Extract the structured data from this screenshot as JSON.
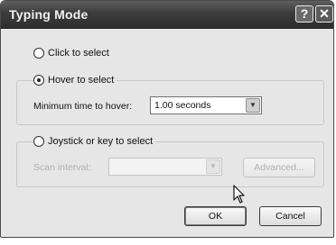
{
  "window": {
    "title": "Typing Mode",
    "help_symbol": "?",
    "close_symbol": "✕"
  },
  "options": {
    "click": {
      "label": "Click to select",
      "selected": false
    },
    "hover": {
      "label": "Hover to select",
      "selected": true,
      "min_time_label": "Minimum time to hover:",
      "min_time_value": "1.00 seconds"
    },
    "joystick": {
      "label": "Joystick or key to select",
      "selected": false,
      "scan_interval_label": "Scan interval:",
      "scan_interval_value": "",
      "advanced_label": "Advanced..."
    }
  },
  "buttons": {
    "ok": "OK",
    "cancel": "Cancel"
  },
  "icons": {
    "dropdown": "chevron-down-icon",
    "cursor": "mouse-pointer-icon"
  }
}
